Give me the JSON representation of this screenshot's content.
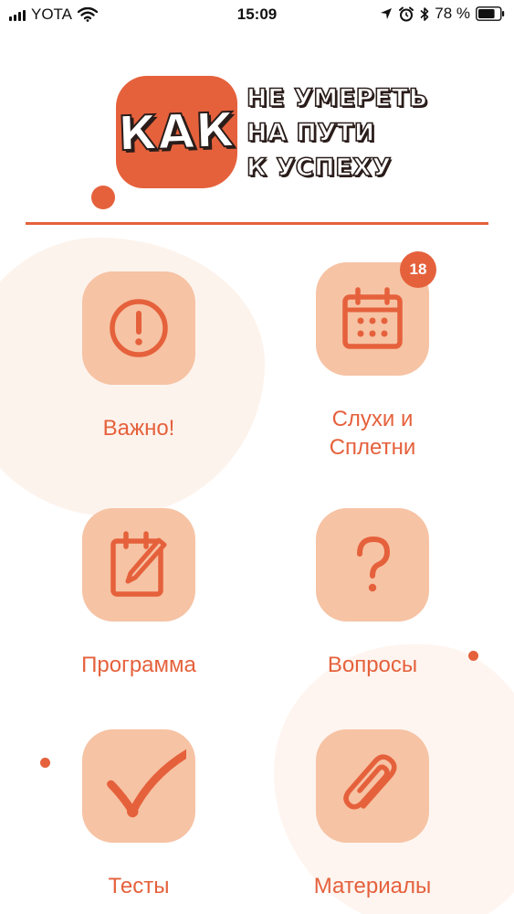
{
  "status_bar": {
    "carrier": "YOTA",
    "time": "15:09",
    "battery_percent": "78 %",
    "battery_level": 0.78,
    "icons": [
      "signal-icon",
      "wifi-icon",
      "location-icon",
      "alarm-icon",
      "bluetooth-icon",
      "battery-icon"
    ]
  },
  "logo": {
    "badge_text": "КАК",
    "tagline": [
      "НЕ УМЕРЕТЬ",
      "НА ПУТИ",
      "К УСПЕХУ"
    ]
  },
  "colors": {
    "accent": "#e5613c",
    "tile_bg": "#f6c3a4",
    "blob": "#fdf1ea"
  },
  "tiles": [
    {
      "label": "Важно!",
      "icon": "exclamation-icon"
    },
    {
      "label": "Слухи и\nСплетни",
      "icon": "calendar-icon",
      "badge": "18"
    },
    {
      "label": "Программа",
      "icon": "notepad-pencil-icon"
    },
    {
      "label": "Вопросы",
      "icon": "question-icon"
    },
    {
      "label": "Тесты",
      "icon": "checkmark-icon"
    },
    {
      "label": "Материалы",
      "icon": "paperclip-icon"
    }
  ]
}
